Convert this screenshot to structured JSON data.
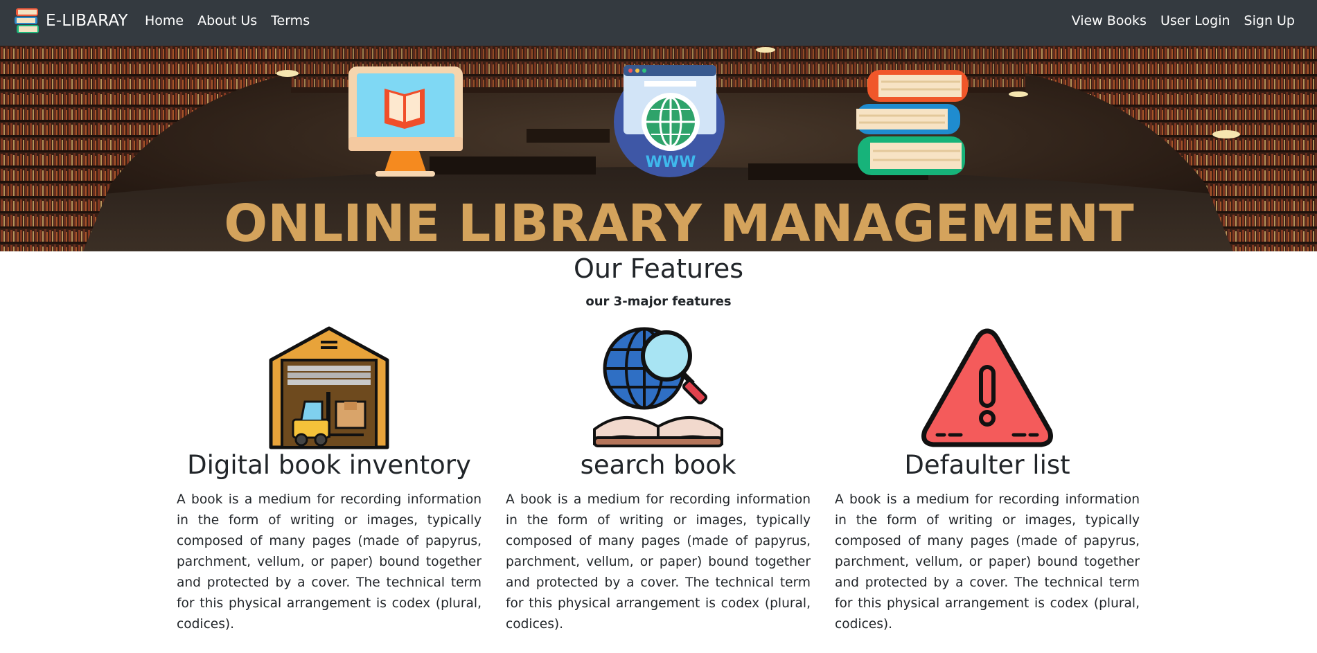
{
  "navbar": {
    "brand": "E-LIBARAY",
    "left_links": [
      "Home",
      "About Us",
      "Terms"
    ],
    "right_links": [
      "View Books",
      "User Login",
      "Sign Up"
    ]
  },
  "hero": {
    "banner_text": "ONLINE LIBRARY MANAGEMENT",
    "www_text": "WWW"
  },
  "features": {
    "title": "Our Features",
    "subtitle": "our 3-major features",
    "items": [
      {
        "title": "Digital book inventory",
        "text": "A book is a medium for recording information in the form of writing or images, typically composed of many pages (made of papyrus, parchment, vellum, or paper) bound together and protected by a cover. The technical term for this physical arrangement is codex (plural, codices).",
        "icon": "warehouse-icon"
      },
      {
        "title": "search book",
        "text": "A book is a medium for recording information in the form of writing or images, typically composed of many pages (made of papyrus, parchment, vellum, or paper) bound together and protected by a cover. The technical term for this physical arrangement is codex (plural, codices).",
        "icon": "globe-search-book-icon"
      },
      {
        "title": "Defaulter list",
        "text": "A book is a medium for recording information in the form of writing or images, typically composed of many pages (made of papyrus, parchment, vellum, or paper) bound together and protected by a cover. The technical term for this physical arrangement is codex (plural, codices).",
        "icon": "warning-icon"
      }
    ]
  },
  "colors": {
    "navbar_bg": "#343a40",
    "banner_text": "#d4a35c",
    "warning_red": "#f45b5b",
    "warehouse_orange": "#e8a33a"
  }
}
